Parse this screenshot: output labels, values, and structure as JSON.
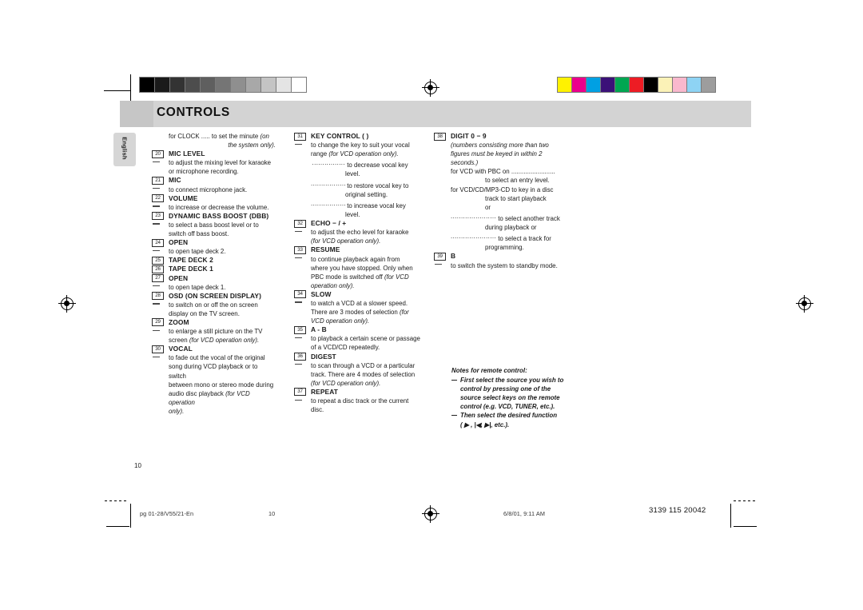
{
  "header": {
    "title": "CONTROLS",
    "language_tab": "English"
  },
  "marks": {
    "greyscale_swatches": [
      "#000000",
      "#1a1a1a",
      "#333333",
      "#4d4d4d",
      "#5f5f5f",
      "#757575",
      "#8f8f8f",
      "#a8a8a8",
      "#c4c4c4",
      "#e4e4e4",
      "#ffffff"
    ],
    "colour_swatches": [
      "#fff200",
      "#ec008c",
      "#00a0e3",
      "#3b1178",
      "#00a651",
      "#ed1c24",
      "#000000",
      "#fbf2b7",
      "#f9b8cd",
      "#8ed3f4",
      "#9d9d9d"
    ]
  },
  "column1": [
    {
      "kind": "cont",
      "text": "for CLOCK ..... to set the minute ",
      "italic": "(on"
    },
    {
      "kind": "cont-right",
      "italic": "the system only)."
    },
    {
      "kind": "item",
      "num": "20",
      "label": "MIC LEVEL"
    },
    {
      "kind": "dash",
      "text": "to adjust the mixing level for karaoke"
    },
    {
      "kind": "plain",
      "text": "or microphone recording."
    },
    {
      "kind": "item",
      "num": "21",
      "label": "MIC"
    },
    {
      "kind": "dash",
      "text": "to connect microphone jack."
    },
    {
      "kind": "item",
      "num": "22",
      "label": "VOLUME"
    },
    {
      "kind": "dash",
      "text": "to increase or decrease the volume."
    },
    {
      "kind": "item",
      "num": "23",
      "label": "DYNAMIC BASS BOOST (DBB)"
    },
    {
      "kind": "dash",
      "text": "to select a bass boost level or to"
    },
    {
      "kind": "plain",
      "text": "switch off bass boost."
    },
    {
      "kind": "item",
      "num": "24",
      "label": "OPEN"
    },
    {
      "kind": "dash",
      "text": "to open tape deck 2."
    },
    {
      "kind": "item",
      "num": "25",
      "label": "TAPE DECK 2"
    },
    {
      "kind": "item",
      "num": "26",
      "label": "TAPE DECK 1"
    },
    {
      "kind": "item",
      "num": "27",
      "label": "OPEN"
    },
    {
      "kind": "dash",
      "text": "to open tape deck 1."
    },
    {
      "kind": "item",
      "num": "28",
      "label": "OSD (ON SCREEN DISPLAY)"
    },
    {
      "kind": "dash",
      "text": "to switch on or off the on screen"
    },
    {
      "kind": "plain",
      "text": "display on the TV screen."
    },
    {
      "kind": "item",
      "num": "29",
      "label": "ZOOM"
    },
    {
      "kind": "dash",
      "text": "to enlarge a still picture on the TV"
    },
    {
      "kind": "plain",
      "text": "screen ",
      "italic": "(for VCD operation only)."
    },
    {
      "kind": "item",
      "num": "30",
      "label": "VOCAL"
    },
    {
      "kind": "dash",
      "text": "to fade out the vocal of the original"
    },
    {
      "kind": "plain",
      "text": "song during VCD playback or to switch"
    },
    {
      "kind": "plain",
      "text": "between mono or stereo mode during"
    },
    {
      "kind": "plain",
      "text": "audio disc playback ",
      "italic": "(for VCD operation"
    },
    {
      "kind": "plain",
      "italic": "only)."
    }
  ],
  "column2": [
    {
      "kind": "item",
      "num": "31",
      "label": "KEY CONTROL  (                )"
    },
    {
      "kind": "dash",
      "text": "to change the key to suit your vocal"
    },
    {
      "kind": "plain",
      "text": "range ",
      "italic": "(for VCD operation only)."
    },
    {
      "kind": "ind-lead",
      "lead": "................",
      "text": "to decrease vocal key"
    },
    {
      "kind": "ind-cont",
      "text": "level."
    },
    {
      "kind": "ind-lead",
      "lead": "...................",
      "text": "to restore vocal key to"
    },
    {
      "kind": "ind-cont",
      "text": "original setting."
    },
    {
      "kind": "ind-lead",
      "lead": "..................",
      "text": "to increase vocal key"
    },
    {
      "kind": "ind-cont",
      "text": "level."
    },
    {
      "kind": "item",
      "num": "32",
      "label": "ECHO  − / +"
    },
    {
      "kind": "dash",
      "text": "to adjust the echo level for karaoke"
    },
    {
      "kind": "plain",
      "italic": "(for VCD operation only)."
    },
    {
      "kind": "item",
      "num": "33",
      "label": "RESUME"
    },
    {
      "kind": "dash",
      "text": "to continue playback again from"
    },
    {
      "kind": "plain",
      "text": "where you have stopped. Only when"
    },
    {
      "kind": "plain",
      "text": "PBC mode is switched off ",
      "italic": "(for VCD"
    },
    {
      "kind": "plain",
      "italic": "operation only)."
    },
    {
      "kind": "item",
      "num": "34",
      "label": "SLOW"
    },
    {
      "kind": "dash",
      "text": "to watch a VCD at a slower speed."
    },
    {
      "kind": "plain",
      "text": "There are 3 modes of selection ",
      "italic": "(for"
    },
    {
      "kind": "plain",
      "italic": "VCD operation only)."
    },
    {
      "kind": "item",
      "num": "35",
      "label": "A - B"
    },
    {
      "kind": "dash",
      "text": "to playback a certain scene or passage"
    },
    {
      "kind": "plain",
      "text": "of a VCD/CD repeatedly."
    },
    {
      "kind": "item",
      "num": "36",
      "label": "DIGEST"
    },
    {
      "kind": "dash",
      "text": "to scan through a VCD or a particular"
    },
    {
      "kind": "plain",
      "text": "track. There are 4 modes of selection"
    },
    {
      "kind": "plain",
      "italic": "(for VCD operation only)."
    },
    {
      "kind": "item",
      "num": "37",
      "label": "REPEAT"
    },
    {
      "kind": "dash",
      "text": "to repeat a disc track or the current"
    },
    {
      "kind": "plain",
      "text": "disc."
    }
  ],
  "column3": [
    {
      "kind": "item",
      "num": "38",
      "label": "DIGIT  0 − 9"
    },
    {
      "kind": "plain",
      "italic": "(numbers consisting more than two"
    },
    {
      "kind": "plain",
      "italic": "figures must be keyed in within 2"
    },
    {
      "kind": "plain",
      "italic": "seconds.)"
    },
    {
      "kind": "plain",
      "text": "for VCD with PBC on ........................."
    },
    {
      "kind": "ind-cont",
      "text": "to select an entry level."
    },
    {
      "kind": "plain",
      "text": "for VCD/CD/MP3-CD     to key in a disc"
    },
    {
      "kind": "ind-cont",
      "text": "track to start playback"
    },
    {
      "kind": "ind-cont",
      "text": "or"
    },
    {
      "kind": "ind-lead3",
      "lead": "......................",
      "text": "to select another track"
    },
    {
      "kind": "ind-cont",
      "text": "during playback or"
    },
    {
      "kind": "ind-lead3",
      "lead": "......................",
      "text": "to select a track for"
    },
    {
      "kind": "ind-cont",
      "text": "programming."
    },
    {
      "kind": "item",
      "num": "39",
      "label": "B"
    },
    {
      "kind": "dash",
      "text": "to switch the system to standby mode."
    }
  ],
  "notes": {
    "heading": "Notes for remote control:",
    "items": [
      [
        "First select the source you wish to",
        "control by pressing one of the",
        "source select keys on the remote",
        "control (e.g.  VCD, TUNER, etc.)."
      ],
      [
        "Then select the desired function",
        "( ▶ ,  |◀,  ▶|,  etc.)."
      ]
    ]
  },
  "folio": "10",
  "footer": {
    "file": "pg 01-28/V55/21-En",
    "page": "10",
    "date": "6/8/01, 9:11 AM",
    "code": "3139 115 20042"
  }
}
